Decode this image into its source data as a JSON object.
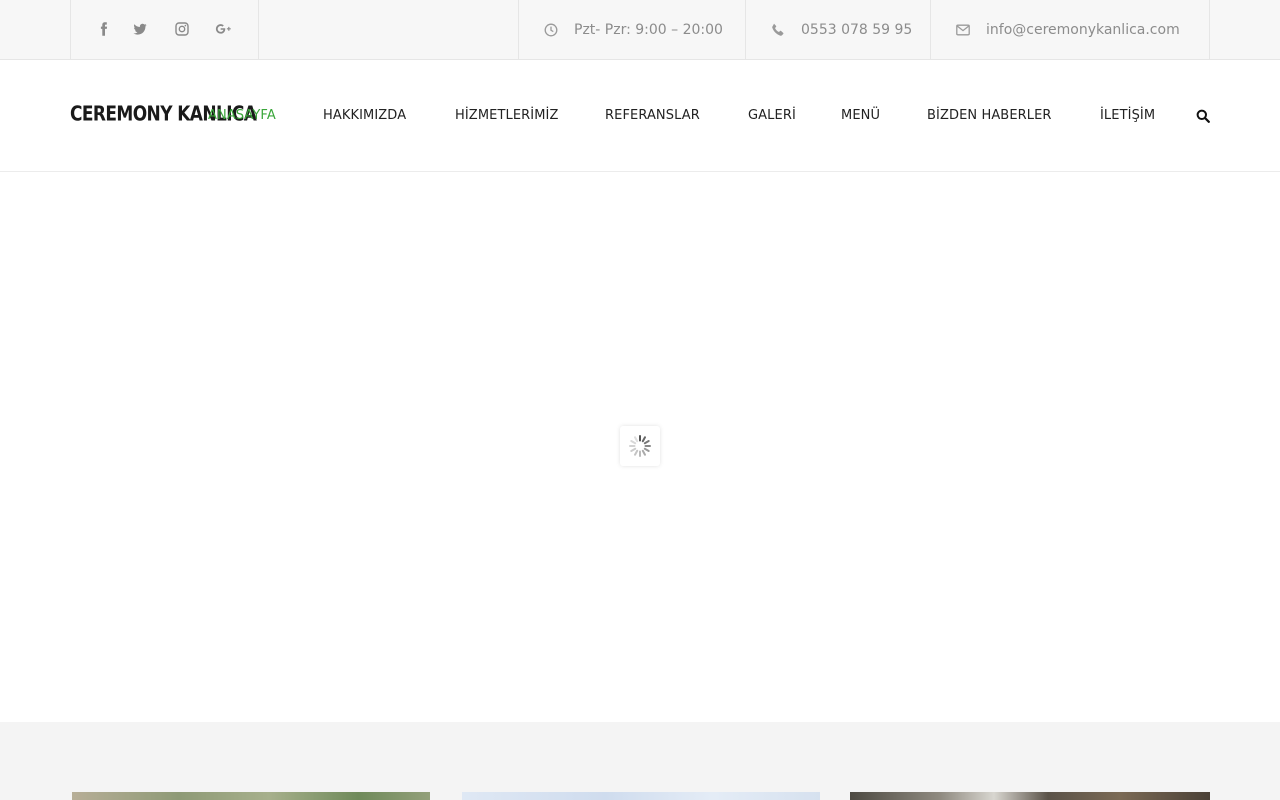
{
  "topbar": {
    "social": [
      {
        "icon": "facebook-icon"
      },
      {
        "icon": "twitter-icon"
      },
      {
        "icon": "instagram-icon"
      },
      {
        "icon": "google-plus-icon"
      }
    ],
    "hours": {
      "icon": "clock-icon",
      "text": "Pzt- Pzr: 9:00 – 20:00"
    },
    "phone": {
      "icon": "phone-icon",
      "text": "0553 078 59 95"
    },
    "email": {
      "icon": "envelope-icon",
      "text": "info@ceremonykanlica.com"
    }
  },
  "header": {
    "logo": "CEREMONY KANLICA",
    "nav": [
      {
        "label": "ANASAYFA",
        "active": true
      },
      {
        "label": "HAKKIMIZDA",
        "active": false
      },
      {
        "label": "HİZMETLERİMİZ",
        "active": false
      },
      {
        "label": "REFERANSLAR",
        "active": false
      },
      {
        "label": "GALERİ",
        "active": false
      },
      {
        "label": "MENÜ",
        "active": false
      },
      {
        "label": "BİZDEN HABERLER",
        "active": false
      },
      {
        "label": "İLETİŞİM",
        "active": false
      }
    ],
    "search_icon": "search-icon"
  },
  "hero": {
    "loader_icon": "spinner-icon"
  },
  "colors": {
    "accent": "#3aa63a",
    "topbar_bg": "#f7f7f7",
    "text": "#222222",
    "muted": "#8c8c8c"
  }
}
